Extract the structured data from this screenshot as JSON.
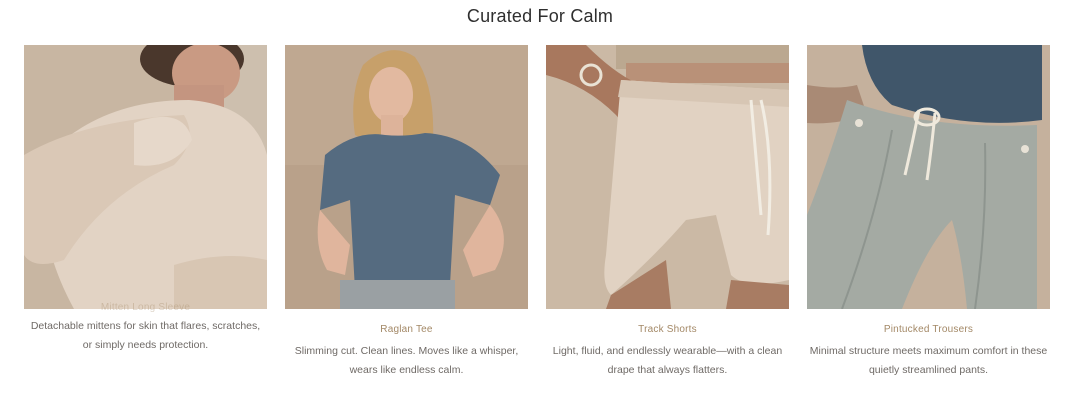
{
  "section": {
    "title": "Curated For Calm"
  },
  "products": [
    {
      "name": "Mitten Long Sleeve",
      "description": "Detachable mittens for skin that flares, scratches, or simply needs protection."
    },
    {
      "name": "Raglan Tee",
      "description": "Slimming cut. Clean lines. Moves like a whisper, wears like endless calm."
    },
    {
      "name": "Track Shorts",
      "description": "Light, fluid, and endlessly wearable—with a clean drape that always flatters."
    },
    {
      "name": "Pintucked Trousers",
      "description": "Minimal structure meets maximum comfort in these quietly streamlined pants."
    }
  ],
  "colors": {
    "title": "#2f2f2f",
    "product_name": "#a38866",
    "description": "#6f6a66"
  }
}
